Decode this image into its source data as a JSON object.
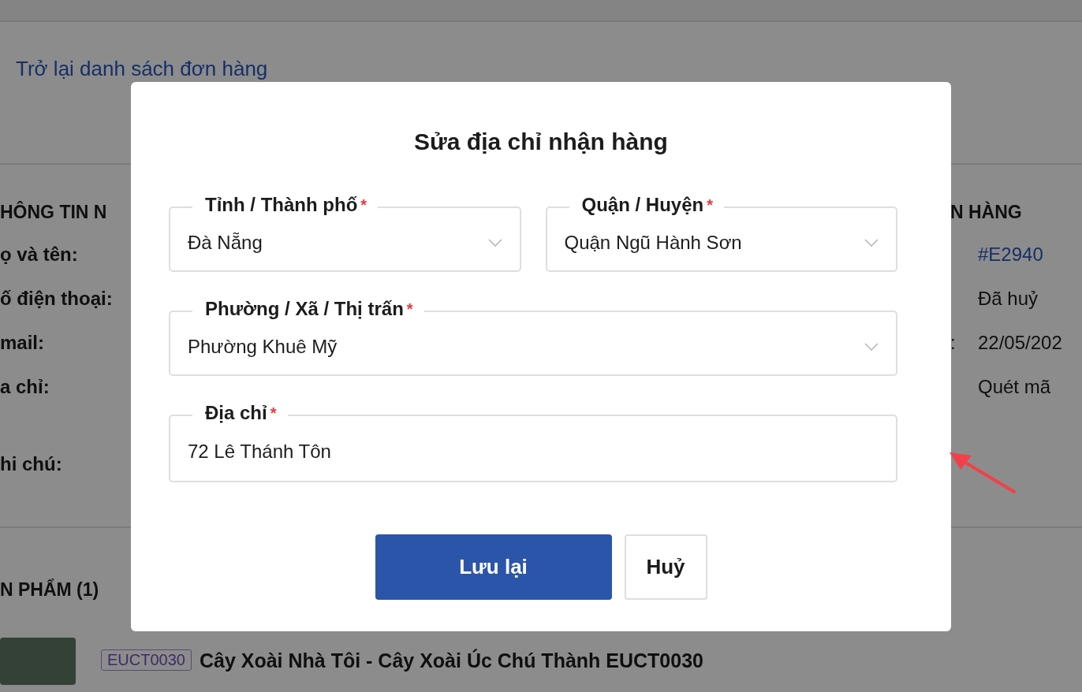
{
  "page": {
    "back_link": "Trở lại danh sách đơn hàng",
    "customer_section": {
      "heading": "HÔNG TIN N",
      "labels": [
        {
          "text": "ọ và tên:",
          "kind": "single"
        },
        {
          "text": "ố điện thoại:",
          "kind": "single"
        },
        {
          "text": "mail:",
          "kind": "single"
        },
        {
          "text": "a chỉ:",
          "kind": "multi"
        },
        {
          "text": "hi chú:",
          "kind": "single"
        }
      ]
    },
    "order_section": {
      "heading": "N HÀNG",
      "rows": [
        {
          "value": "#E2940",
          "kind": "link"
        },
        {
          "value": "Đã huỷ",
          "kind": "plain"
        },
        {
          "label": ":",
          "value": "22/05/202",
          "kind": "plain"
        },
        {
          "value": "Quét mã",
          "kind": "plain"
        }
      ]
    },
    "products": {
      "heading": "N PHẨM (1)",
      "items": [
        {
          "tag": "EUCT0030",
          "name": "Cây Xoài Nhà Tôi - Cây Xoài Úc Chú Thành EUCT0030"
        }
      ]
    }
  },
  "modal": {
    "title": "Sửa địa chỉ nhận hàng",
    "fields": [
      {
        "label": "Tỉnh / Thành phố",
        "required_mark": "*",
        "value": "Đà Nẵng",
        "kind": "select"
      },
      {
        "label": "Quận / Huyện",
        "required_mark": "*",
        "value": "Quận Ngũ Hành Sơn",
        "kind": "select"
      },
      {
        "label": "Phường / Xã / Thị trấn",
        "required_mark": "*",
        "value": "Phường Khuê Mỹ",
        "kind": "select"
      },
      {
        "label": "Địa chỉ",
        "required_mark": "*",
        "value": "72 Lê Thánh Tôn",
        "kind": "text"
      }
    ],
    "buttons": [
      {
        "label": "Lưu lại",
        "kind": "primary"
      },
      {
        "label": "Huỷ",
        "kind": "secondary"
      }
    ]
  }
}
